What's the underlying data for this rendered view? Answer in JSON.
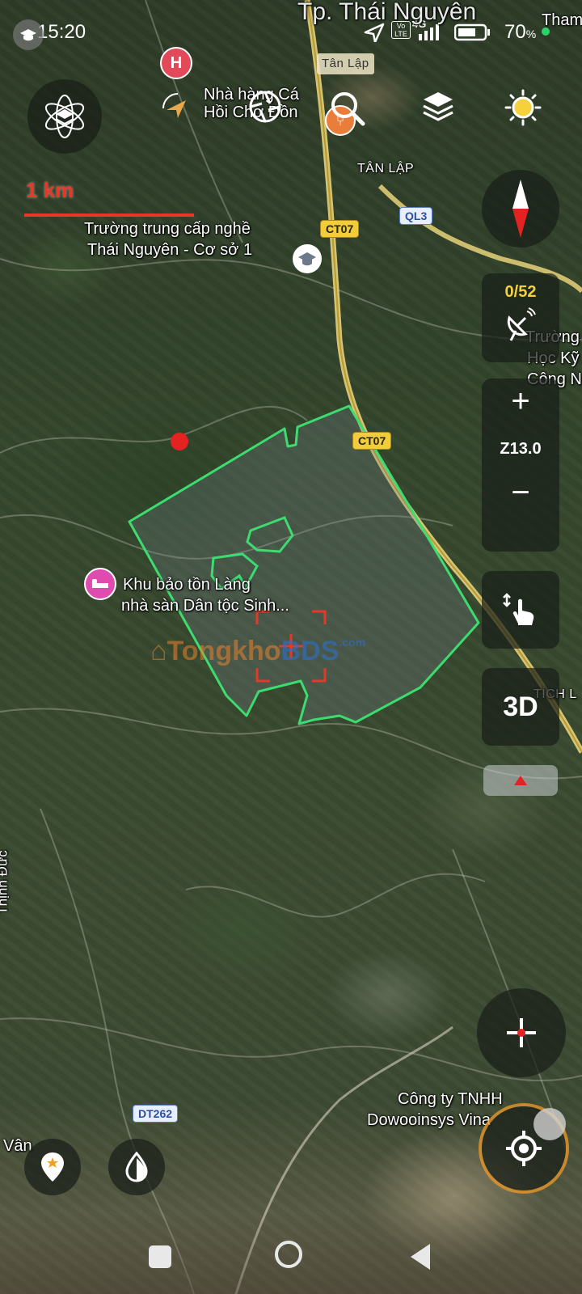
{
  "status_bar": {
    "time": "15:20",
    "network": "4G",
    "volte": "Vo LTE",
    "battery": "70",
    "battery_unit": "%"
  },
  "scale_bar": {
    "label": "1 km"
  },
  "map_labels": {
    "city": "Tp. Thái Nguyên",
    "tan_lap_road": "Tân Lập",
    "tan_lap_area": "TÂN LẬP",
    "restaurant": "Nhà hàng Cá Hồi Chợ Đồn",
    "school_line1": "Trường trung cấp nghề",
    "school_line2": "Thái Nguyên - Cơ sở 1",
    "tech_school_line1": "Trường",
    "tech_school_line2": "Học Kỹ T",
    "tech_school_line3": "Công Ng",
    "reserve_line1": "Khu bảo tồn Làng",
    "reserve_line2": "nhà sàn Dân tộc Sinh...",
    "tich_luong": "TÍCH L",
    "thinh_duc": "Thịnh Đức",
    "company_line1": "Công ty TNHH",
    "company_line2": "Dowooinsys Vina",
    "van": "Vân",
    "tham": "Tham",
    "watermark_a": "Tongkho",
    "watermark_b": "BDS",
    "watermark_c": ".com"
  },
  "road_shields": {
    "ct07_north": "CT07",
    "ct07_south": "CT07",
    "ql3": "QL3",
    "dt262": "DT262"
  },
  "controls": {
    "satellites": "0/52",
    "zoom_level": "Z13.0",
    "zoom_in": "+",
    "zoom_out": "−",
    "mode_3d": "3D"
  },
  "icons": {
    "layer_switcher": "atom-layers-icon",
    "camera": "camera-icon",
    "search": "search-icon",
    "layers": "layers-stack-icon",
    "brightness": "sun-icon",
    "compass": "compass-icon",
    "satellite": "satellite-dish-icon",
    "touch": "touch-swipe-icon",
    "crosshair": "crosshair-icon",
    "locate": "gps-locate-icon",
    "add_marker": "map-pin-star-icon",
    "water": "water-drop-icon"
  },
  "colors": {
    "boundary": "#3ddc70",
    "scale": "#e23a2a",
    "shield": "#f2cc3a",
    "satellite_count": "#f5d23c"
  }
}
